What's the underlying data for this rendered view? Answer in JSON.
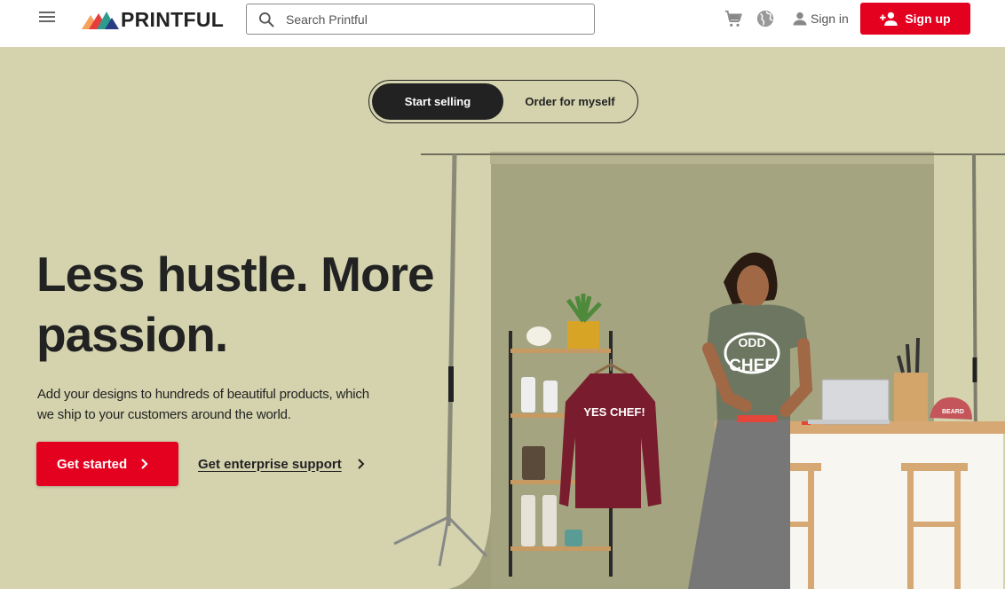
{
  "header": {
    "menu_icon": "hamburger-menu-icon",
    "logo_text": "PRINTFUL",
    "search": {
      "placeholder": "Search Printful",
      "value": ""
    },
    "cart_icon": "cart-icon",
    "language_icon": "globe-icon",
    "signin_label": "Sign in",
    "signup_label": "Sign up"
  },
  "hero": {
    "toggle": {
      "active": "Start selling",
      "inactive": "Order for myself"
    },
    "headline": "Less hustle. More passion.",
    "headline_line1": "Less hustle. More",
    "headline_line2": "passion.",
    "subtext": "Add your designs to hundreds of beautiful products, which we ship to your customers around the world.",
    "cta_primary": "Get started",
    "cta_secondary": "Get enterprise support",
    "image_text": {
      "sweatshirt": "YES CHEF!",
      "tshirt_line1": "ODD",
      "tshirt_line2": "CHEF",
      "cap": "BEARD"
    }
  },
  "colors": {
    "brand_red": "#e4001f",
    "hero_bg": "#d4d3ae",
    "backdrop": "#a5a481",
    "dark": "#222222"
  }
}
